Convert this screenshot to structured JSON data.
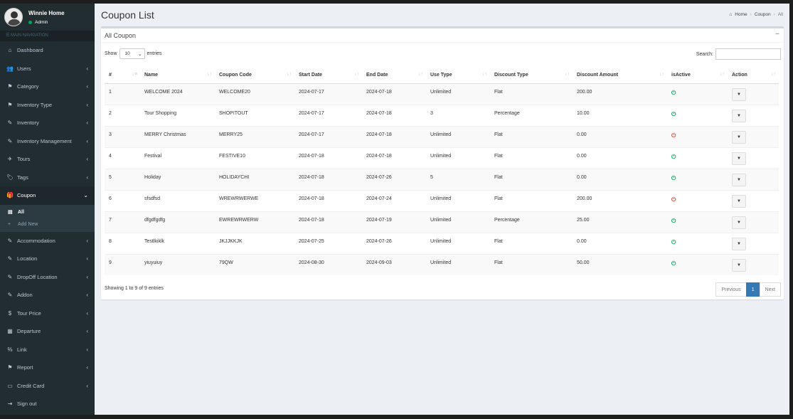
{
  "user": {
    "name": "Winnie Home",
    "role": "Admin"
  },
  "sidebar": {
    "header": "MAIN NAVIGATION",
    "items": [
      {
        "label": "Dashboard",
        "icon": "⌂",
        "chevron": ""
      },
      {
        "label": "Users",
        "icon": "👥",
        "chevron": "‹"
      },
      {
        "label": "Category",
        "icon": "⚑",
        "chevron": "‹"
      },
      {
        "label": "Inventory Type",
        "icon": "⚑",
        "chevron": "‹"
      },
      {
        "label": "Inventory",
        "icon": "✎",
        "chevron": "‹"
      },
      {
        "label": "Inventory Management",
        "icon": "✎",
        "chevron": "‹"
      },
      {
        "label": "Tours",
        "icon": "✈",
        "chevron": "‹"
      },
      {
        "label": "Tags",
        "icon": "🏷",
        "chevron": "‹"
      },
      {
        "label": "Coupon",
        "icon": "🎁",
        "chevron": "⌄"
      }
    ],
    "submenu": [
      {
        "label": "All",
        "icon": "▤"
      },
      {
        "label": "Add New",
        "icon": "+"
      }
    ],
    "items2": [
      {
        "label": "Accommodation",
        "icon": "✎",
        "chevron": "‹"
      },
      {
        "label": "Location",
        "icon": "✎",
        "chevron": "‹"
      },
      {
        "label": "DropOff Location",
        "icon": "✎",
        "chevron": "‹"
      },
      {
        "label": "Addon",
        "icon": "✎",
        "chevron": "‹"
      },
      {
        "label": "Tour Price",
        "icon": "$",
        "chevron": "‹"
      },
      {
        "label": "Departure",
        "icon": "▦",
        "chevron": "‹"
      },
      {
        "label": "Link",
        "icon": "%",
        "chevron": "‹"
      },
      {
        "label": "Report",
        "icon": "⚑",
        "chevron": "‹"
      },
      {
        "label": "Credit Card",
        "icon": "▭",
        "chevron": "‹"
      },
      {
        "label": "Sign out",
        "icon": "⇥",
        "chevron": ""
      }
    ]
  },
  "page": {
    "title": "Coupon List",
    "breadcrumb": {
      "home": "Home",
      "section": "Coupon",
      "current": "All"
    }
  },
  "box": {
    "title": "All Coupon",
    "collapse": "−"
  },
  "controls": {
    "show": "Show",
    "entries_value": "10",
    "entries": "entries",
    "search": "Search:"
  },
  "table": {
    "columns": [
      "#",
      "Name",
      "Coupon Code",
      "Start Date",
      "End Date",
      "Use Type",
      "Discount Type",
      "Discount Amount",
      "isActive",
      "Action"
    ],
    "rows": [
      {
        "n": "1",
        "name": "WELCOME 2024",
        "code": "WELCOME20",
        "start": "2024-07-17",
        "end": "2024-07-18",
        "use": "Unlimited",
        "dtype": "Flat",
        "amount": "200.00",
        "active": true
      },
      {
        "n": "2",
        "name": "Tour Shopping",
        "code": "SHOPITOUT",
        "start": "2024-07-17",
        "end": "2024-07-18",
        "use": "3",
        "dtype": "Percentage",
        "amount": "10.00",
        "active": true
      },
      {
        "n": "3",
        "name": "MERRY Christmas",
        "code": "MERRY25",
        "start": "2024-07-17",
        "end": "2024-07-18",
        "use": "Unlimited",
        "dtype": "Flat",
        "amount": "0.00",
        "active": false
      },
      {
        "n": "4",
        "name": "Festival",
        "code": "FESTIVE10",
        "start": "2024-07-18",
        "end": "2024-07-18",
        "use": "Unlimited",
        "dtype": "Flat",
        "amount": "0.00",
        "active": true
      },
      {
        "n": "5",
        "name": "Holiday",
        "code": "HOLIDAYCHI",
        "start": "2024-07-18",
        "end": "2024-07-26",
        "use": "5",
        "dtype": "Flat",
        "amount": "0.00",
        "active": true
      },
      {
        "n": "6",
        "name": "sfsdfsd",
        "code": "WREWRWERWE",
        "start": "2024-07-18",
        "end": "2024-07-24",
        "use": "Unlimited",
        "dtype": "Flat",
        "amount": "200.00",
        "active": false
      },
      {
        "n": "7",
        "name": "dfgdfgdfg",
        "code": "EWREWRWERW",
        "start": "2024-07-18",
        "end": "2024-07-19",
        "use": "Unlimited",
        "dtype": "Percentage",
        "amount": "25.00",
        "active": true
      },
      {
        "n": "8",
        "name": "Testlkiklk",
        "code": "JKJJKKJK",
        "start": "2024-07-25",
        "end": "2024-07-26",
        "use": "Unlimited",
        "dtype": "Flat",
        "amount": "0.00",
        "active": true
      },
      {
        "n": "9",
        "name": "yiuyuiuy",
        "code": "79QW",
        "start": "2024-08-30",
        "end": "2024-09-03",
        "use": "Unlimited",
        "dtype": "Flat",
        "amount": "50.00",
        "active": true
      }
    ]
  },
  "footer": {
    "info": "Showing 1 to 9 of 9 entries",
    "prev": "Previous",
    "page": "1",
    "next": "Next"
  },
  "colors": {
    "sidebar": "#222d32",
    "active_on": "#00a65a",
    "active_off": "#dd4b39",
    "primary": "#337ab7"
  }
}
